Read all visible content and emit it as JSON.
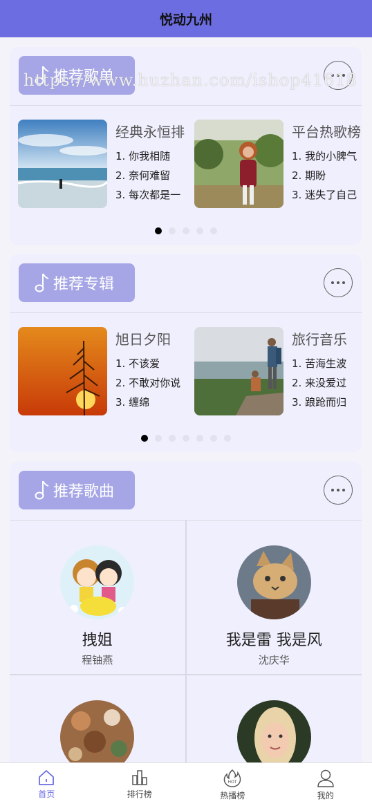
{
  "app": {
    "title": "悦动九州"
  },
  "watermark": "https://www.huzhan.com/ishop41618",
  "sections": {
    "playlists": {
      "title": "推荐歌单",
      "items": [
        {
          "name": "经典永恒排",
          "songs": [
            "1. 你我相随",
            "2. 奈何难留",
            "3. 每次都是一"
          ]
        },
        {
          "name": "平台热歌榜",
          "songs": [
            "1. 我的小脾气",
            "2. 期盼",
            "3. 迷失了自己"
          ]
        }
      ]
    },
    "albums": {
      "title": "推荐专辑",
      "items": [
        {
          "name": "旭日夕阳",
          "songs": [
            "1. 不该爱",
            "2. 不敢对你说",
            "3. 缠绵"
          ]
        },
        {
          "name": "旅行音乐",
          "songs": [
            "1. 苦海生波",
            "2. 来没爱过",
            "3. 踉跄而归"
          ]
        }
      ]
    },
    "songs": {
      "title": "推荐歌曲",
      "items": [
        {
          "name": "拽姐",
          "singer": "程铀燕"
        },
        {
          "name": "我是雷 我是风",
          "singer": "沈庆华"
        }
      ]
    }
  },
  "tabbar": [
    {
      "label": "首页",
      "icon": "home-icon",
      "active": true
    },
    {
      "label": "排行榜",
      "icon": "chart-building-icon"
    },
    {
      "label": "热播榜",
      "icon": "hot-flame-icon"
    },
    {
      "label": "我的",
      "icon": "user-icon"
    }
  ],
  "colors": {
    "accent": "#6b6de0",
    "tag": "#a6a6e6",
    "card": "#efeffd"
  }
}
